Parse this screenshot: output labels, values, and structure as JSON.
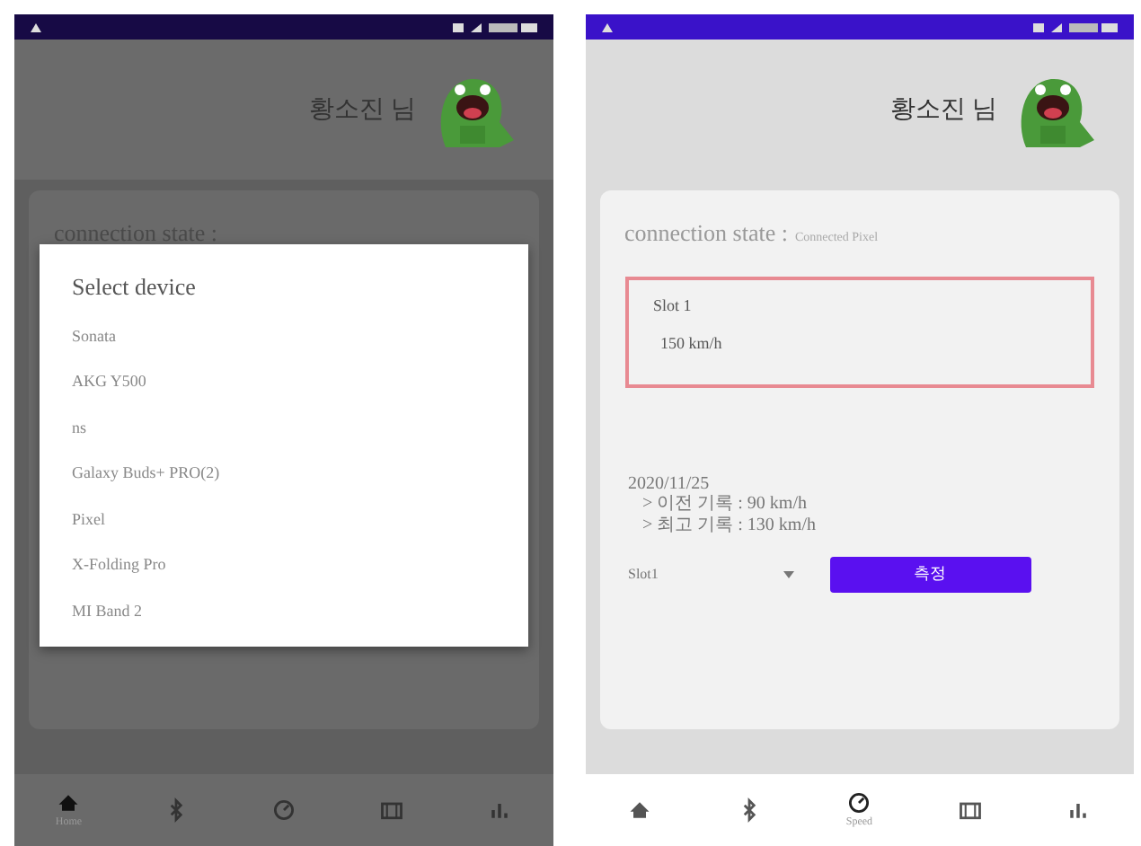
{
  "screens": [
    {
      "dimmed": true,
      "header": {
        "user_name": "황소진 님"
      },
      "card": {
        "title": "connection state :"
      },
      "dialog": {
        "title": "Select device",
        "items": [
          "Sonata",
          "AKG Y500",
          "ns",
          "Galaxy Buds+ PRO(2)",
          "Pixel",
          "X-Folding Pro",
          "MI Band 2"
        ]
      },
      "nav": [
        {
          "kind": "home",
          "selected": true,
          "label": "Home"
        },
        {
          "kind": "bluetooth",
          "selected": false
        },
        {
          "kind": "speed",
          "selected": false
        },
        {
          "kind": "board",
          "selected": false
        },
        {
          "kind": "chart",
          "selected": false
        }
      ]
    },
    {
      "dimmed": false,
      "header": {
        "user_name": "황소진 님"
      },
      "card": {
        "title": "connection state :",
        "subtitle": "Connected Pixel"
      },
      "slot": {
        "name": "Slot 1",
        "speed": "150 km/h"
      },
      "record": {
        "date": "2020/11/25",
        "lines": [
          "> 이전 기록 : 90 km/h",
          "> 최고 기록 : 130 km/h"
        ]
      },
      "select": {
        "value": "Slot1"
      },
      "button": "측정",
      "nav": [
        {
          "kind": "home",
          "selected": false
        },
        {
          "kind": "bluetooth",
          "selected": false
        },
        {
          "kind": "speed",
          "selected": true,
          "label": "Speed"
        },
        {
          "kind": "board",
          "selected": false
        },
        {
          "kind": "chart",
          "selected": false
        }
      ]
    }
  ]
}
